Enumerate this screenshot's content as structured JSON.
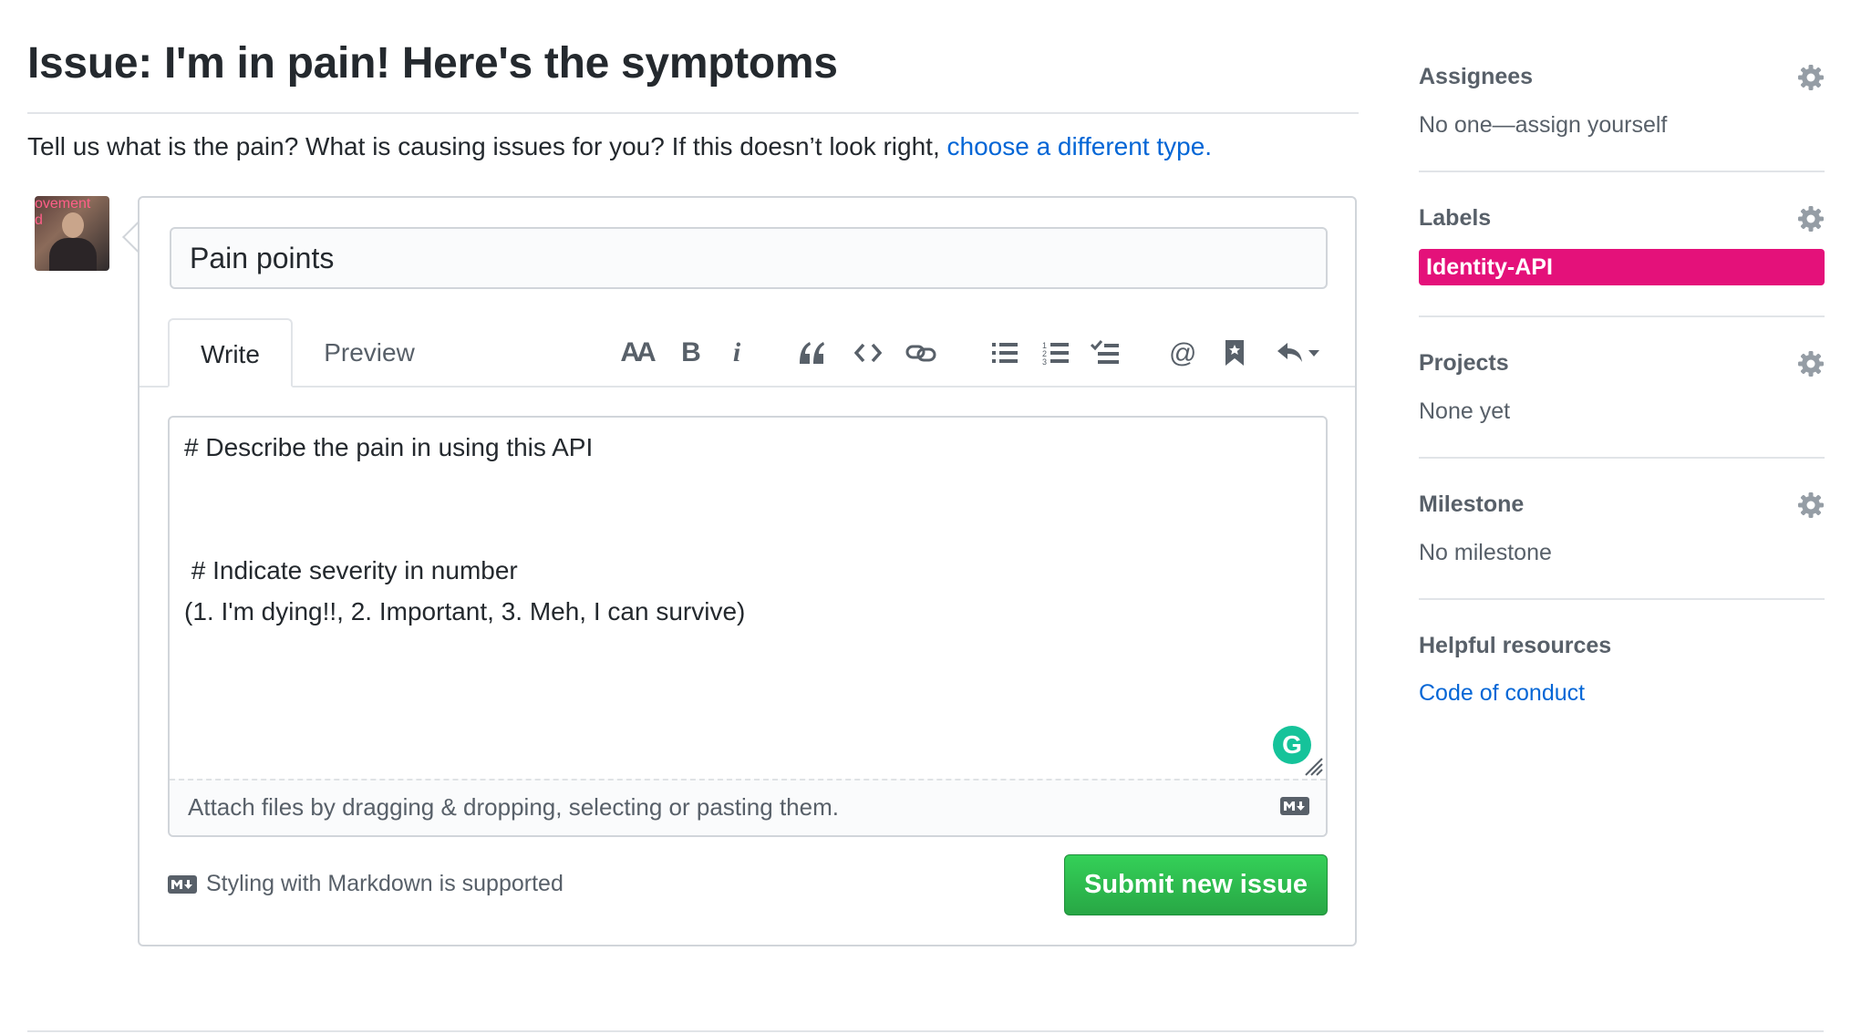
{
  "page": {
    "title": "Issue: I'm in pain! Here's the symptoms",
    "intro_text": "Tell us what is the pain? What is causing issues for you? If this doesn’t look right, ",
    "intro_link": "choose a different type."
  },
  "avatar": {
    "overlay_text": "ovement\nd"
  },
  "form": {
    "title_value": "Pain points",
    "tabs": [
      {
        "label": "Write",
        "active": true
      },
      {
        "label": "Preview",
        "active": false
      }
    ],
    "toolbar": {
      "heading": "AA",
      "bold": "B",
      "italic": "i",
      "icons": [
        "quote-icon",
        "code-icon",
        "link-icon",
        "unordered-list-icon",
        "ordered-list-icon",
        "task-list-icon",
        "mention-icon",
        "saved-reply-icon",
        "reply-icon"
      ]
    },
    "body_text": "# Describe the pain in using this API\n\n\n # Indicate severity in number\n(1. I'm dying!!, 2. Important, 3. Meh, I can survive)",
    "attach_text": "Attach files by dragging & dropping, selecting or pasting them.",
    "grammarly_glyph": "G",
    "markdown_note": "Styling with Markdown is supported",
    "submit_label": "Submit new issue"
  },
  "sidebar": {
    "assignees": {
      "heading": "Assignees",
      "value": "No one—assign yourself"
    },
    "labels": {
      "heading": "Labels",
      "items": [
        {
          "name": "Identity-API",
          "color": "#e4117a"
        }
      ]
    },
    "projects": {
      "heading": "Projects",
      "value": "None yet"
    },
    "milestone": {
      "heading": "Milestone",
      "value": "No milestone"
    },
    "helpful": {
      "heading": "Helpful resources",
      "link": "Code of conduct"
    }
  },
  "colors": {
    "link": "#0366d6",
    "submit": "#28a745",
    "label": "#e4117a",
    "grammarly": "#15c39a"
  }
}
